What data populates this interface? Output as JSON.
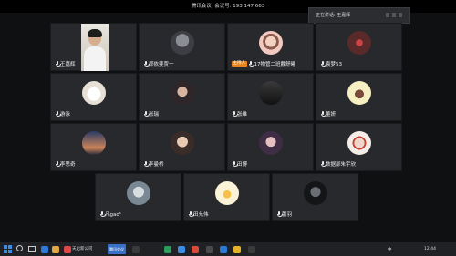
{
  "meeting": {
    "title": "腾讯会议  会议号: 193 147 663",
    "speaking_prefix": "正在讲话:",
    "speaking_name": "王嘉辉"
  },
  "participants": [
    {
      "name": "王嘉辉",
      "video": true,
      "avatar_color": "#d9d3c8"
    },
    {
      "name": "郑依斐贾一",
      "avatar_color": "#5a5d63"
    },
    {
      "name": "17物管二班戴舒曦",
      "host_label": "主持人",
      "avatar_color": "#e9b9b0"
    },
    {
      "name": "袁梦53",
      "avatar_color": "#7a3b3b"
    },
    {
      "name": "游泳",
      "avatar_color": "#f1ede6"
    },
    {
      "name": "张瑞",
      "avatar_color": "#3a3438"
    },
    {
      "name": "张维",
      "avatar_color": "#2a2a2a"
    },
    {
      "name": "董妍",
      "avatar_color": "#f4e7a8"
    },
    {
      "name": "李思奇",
      "avatar_color": "#3b4a72"
    },
    {
      "name": "李曼桥",
      "avatar_color": "#c6a690"
    },
    {
      "name": "田博",
      "avatar_color": "#4a3850"
    },
    {
      "name": "数据部朱宇欣",
      "avatar_color": "#e9dcd3"
    },
    {
      "name": "凡gao¹",
      "avatar_color": "#9aa4ae"
    },
    {
      "name": "田允伟",
      "avatar_color": "#f2e5b8"
    },
    {
      "name": "蕾羽",
      "avatar_color": "#1f2124"
    }
  ],
  "taskbar": {
    "app1_label": "天启新公司",
    "app2_label": "腾讯会议",
    "ime": "中",
    "time": "12:44"
  }
}
